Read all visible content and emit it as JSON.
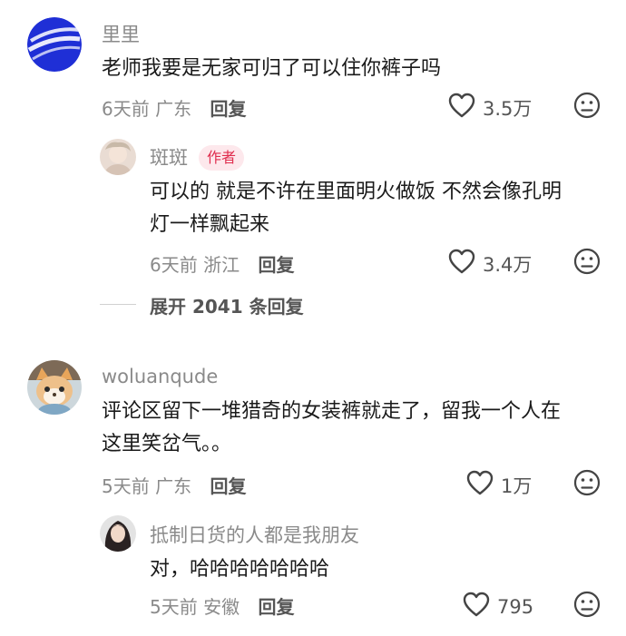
{
  "comments": [
    {
      "username": "里里",
      "text": "老师我要是无家可归了可以住你裤子吗",
      "time": "6天前",
      "location": "广东",
      "reply_label": "回复",
      "likes": "3.5万",
      "replies": [
        {
          "username": "斑斑",
          "badge": "作者",
          "text_line1": "可以的 就是不许在里面明火做饭 不然会像孔明",
          "text_line2": "灯一样飘起来",
          "time": "6天前",
          "location": "浙江",
          "reply_label": "回复",
          "likes": "3.4万"
        }
      ],
      "expand_label": "展开 2041 条回复"
    },
    {
      "username": "woluanqude",
      "text_line1": "评论区留下一堆猎奇的女装裤就走了，留我一个人在",
      "text_line2": "这里笑岔气。。",
      "time": "5天前",
      "location": "广东",
      "reply_label": "回复",
      "likes": "1万",
      "replies": [
        {
          "username": "抵制日货的人都是我朋友",
          "text": "对，哈哈哈哈哈哈哈",
          "time": "5天前",
          "location": "安徽",
          "reply_label": "回复",
          "likes": "795"
        }
      ]
    }
  ],
  "icons": {
    "like": "heart-outline-icon",
    "dislike": "frown-face-icon"
  },
  "colors": {
    "badge_bg": "#fde8ec",
    "badge_text": "#e02e4f",
    "meta": "#8a8a8a"
  }
}
